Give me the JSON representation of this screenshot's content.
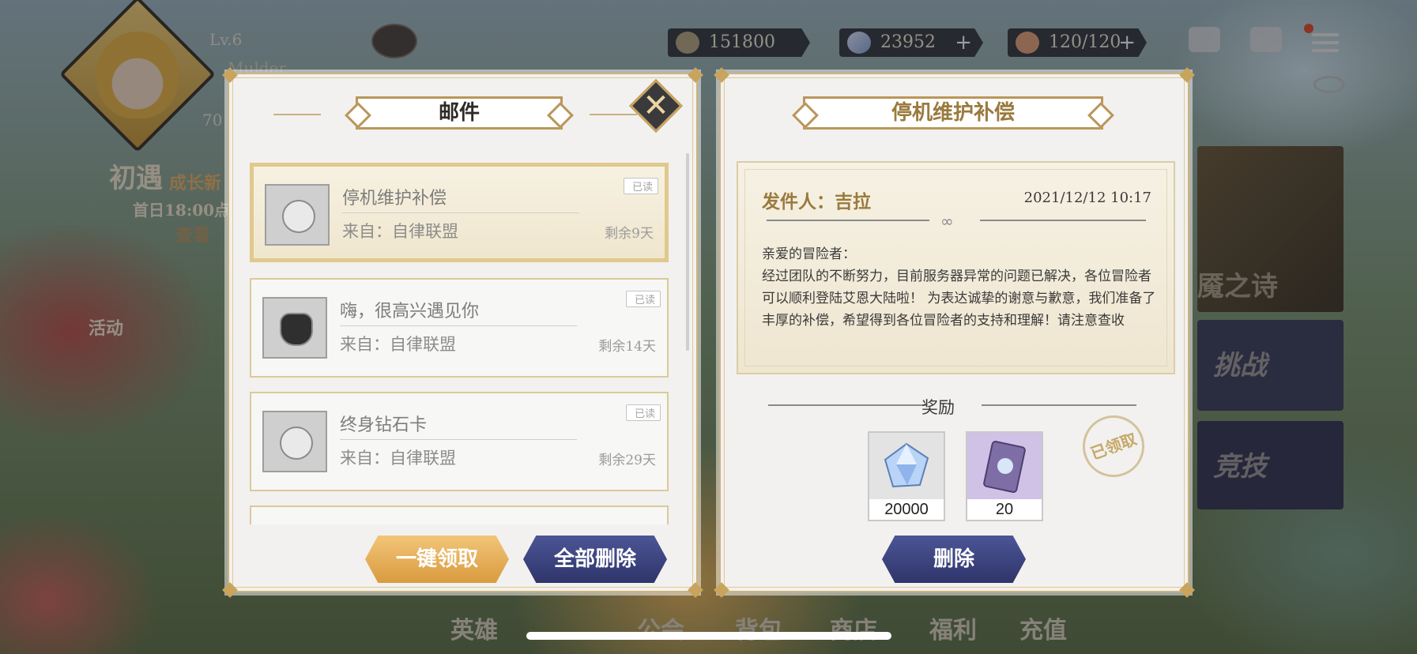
{
  "top_bar": {
    "level": "Lv.6",
    "player_name_partial": "Mulder",
    "level_partial_num": "70",
    "resources": [
      {
        "icon": "coin-icon",
        "value": "151800",
        "has_plus": false
      },
      {
        "icon": "diamond-icon",
        "value": "23952",
        "has_plus": true
      },
      {
        "icon": "cake-stamina-icon",
        "value": "120/120",
        "has_plus": true
      }
    ],
    "plus_glyph": "+"
  },
  "background_text": {
    "event_title": "初遇",
    "event_sub": "成长新",
    "event_time": "首日18:00点",
    "event_link": "查看",
    "activity": "活动",
    "side_nightmare": "魇之诗",
    "side_challenge": "挑战",
    "side_arena": "竞技",
    "bottom_nav": [
      "英雄",
      "公会",
      "背包",
      "商店",
      "福利",
      "充值"
    ]
  },
  "mail_panel": {
    "title": "邮件",
    "close_glyph": "✕",
    "items": [
      {
        "title": "停机维护补偿",
        "from": "来自：自律联盟",
        "remain": "剩余9天",
        "badge": "已读",
        "thumb": "gift-icon",
        "selected": true
      },
      {
        "title": "嗨，很高兴遇见你",
        "from": "来自：自律联盟",
        "remain": "剩余14天",
        "badge": "已读",
        "thumb": "portrait-icon",
        "selected": false
      },
      {
        "title": "终身钻石卡",
        "from": "来自：自律联盟",
        "remain": "剩余29天",
        "badge": "已读",
        "thumb": "gift-icon",
        "selected": false
      }
    ],
    "btn_claim_all": "一键领取",
    "btn_delete_all": "全部删除"
  },
  "detail_panel": {
    "title": "停机维护补偿",
    "sender": "发件人：吉拉",
    "date": "2021/12/12 10:17",
    "greeting": "亲爱的冒险者：",
    "body": "经过团队的不断努力，目前服务器异常的问题已解决，各位冒险者可以顺利登陆艾恩大陆啦！ 为表达诚挚的谢意与歉意，我们准备了丰厚的补偿，希望得到各位冒险者的支持和理解！请注意查收",
    "reward_heading": "奖励",
    "rewards": [
      {
        "icon": "diamond-crystal-icon",
        "count": "20000"
      },
      {
        "icon": "card-ticket-icon",
        "count": "20"
      }
    ],
    "claimed_stamp": "已领取",
    "btn_delete": "删除"
  },
  "colors": {
    "gold": "#c8a45e",
    "navy": "#2f356a",
    "orange": "#d99b3e"
  }
}
